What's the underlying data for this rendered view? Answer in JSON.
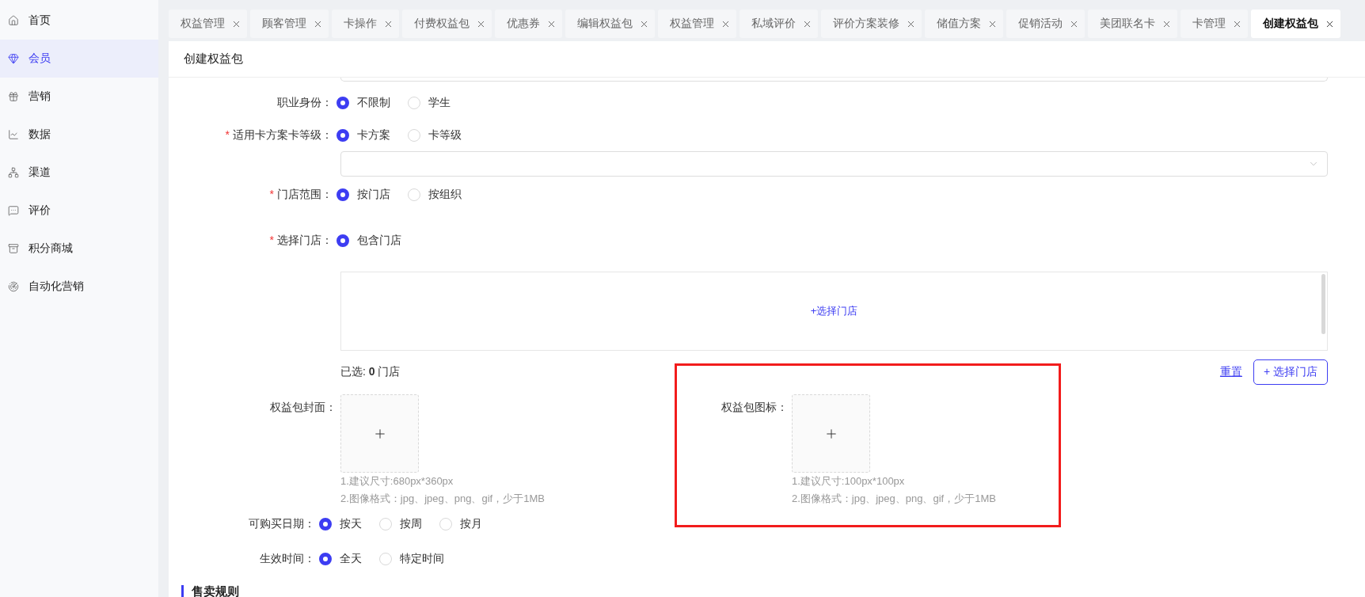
{
  "sidebar": {
    "items": [
      {
        "label": "首页",
        "selected": false
      },
      {
        "label": "会员",
        "selected": true
      },
      {
        "label": "营销",
        "selected": false
      },
      {
        "label": "数据",
        "selected": false
      },
      {
        "label": "渠道",
        "selected": false
      },
      {
        "label": "评价",
        "selected": false
      },
      {
        "label": "积分商城",
        "selected": false
      },
      {
        "label": "自动化营销",
        "selected": false
      }
    ]
  },
  "tabs": [
    {
      "label": "权益管理",
      "selected": false
    },
    {
      "label": "顾客管理",
      "selected": false
    },
    {
      "label": "卡操作",
      "selected": false
    },
    {
      "label": "付费权益包",
      "selected": false
    },
    {
      "label": "优惠券",
      "selected": false
    },
    {
      "label": "编辑权益包",
      "selected": false
    },
    {
      "label": "权益管理",
      "selected": false
    },
    {
      "label": "私域评价",
      "selected": false
    },
    {
      "label": "评价方案装修",
      "selected": false
    },
    {
      "label": "储值方案",
      "selected": false
    },
    {
      "label": "促销活动",
      "selected": false
    },
    {
      "label": "美团联名卡",
      "selected": false
    },
    {
      "label": "卡管理",
      "selected": false
    },
    {
      "label": "创建权益包",
      "selected": true
    }
  ],
  "page_title": "创建权益包",
  "form": {
    "rows": [
      {
        "kind": "partial_input"
      },
      {
        "kind": "radio",
        "label": "职业身份：",
        "options": [
          {
            "label": "不限制",
            "selected": true
          },
          {
            "label": "学生",
            "selected": false
          }
        ]
      },
      {
        "kind": "radio",
        "required_mark": "*",
        "label": "适用卡方案卡等级：",
        "options": [
          {
            "label": "卡方案",
            "selected": true
          },
          {
            "label": "卡等级",
            "selected": false
          }
        ]
      },
      {
        "kind": "select"
      },
      {
        "kind": "radio",
        "required_mark": "*",
        "label": "门店范围：",
        "options": [
          {
            "label": "按门店",
            "selected": true
          },
          {
            "label": "按组织",
            "selected": false
          }
        ]
      },
      {
        "kind": "radio",
        "required_mark": "*",
        "label": "选择门店：",
        "options": [
          {
            "label": "包含门店",
            "selected": true
          }
        ]
      },
      {
        "kind": "store_box",
        "link": "+选择门店"
      },
      {
        "kind": "store_actions",
        "summary": "已选: **0** 门店",
        "reset": "重置",
        "button": "+ 选择门店"
      },
      {
        "kind": "uploads",
        "items": [
          {
            "label": "权益包封面：",
            "highlighted": false,
            "hints": [
              "1.建议尺寸:680px*360px",
              "2.图像格式：jpg、jpeg、png、gif，少于1MB"
            ]
          },
          {
            "label": "权益包图标：",
            "highlighted": true,
            "hints": [
              "1.建议尺寸:100px*100px",
              "2.图像格式：jpg、jpeg、png、gif，少于1MB"
            ]
          }
        ]
      },
      {
        "kind": "radio_short",
        "label": "可购买日期：",
        "options": [
          {
            "label": "按天",
            "selected": true
          },
          {
            "label": "按周",
            "selected": false
          },
          {
            "label": "按月",
            "selected": false
          }
        ]
      },
      {
        "kind": "radio_short",
        "label": "生效时间：",
        "options": [
          {
            "label": "全天",
            "selected": true
          },
          {
            "label": "特定时间",
            "selected": false
          }
        ]
      },
      {
        "kind": "section",
        "label": "售卖规则"
      }
    ]
  }
}
